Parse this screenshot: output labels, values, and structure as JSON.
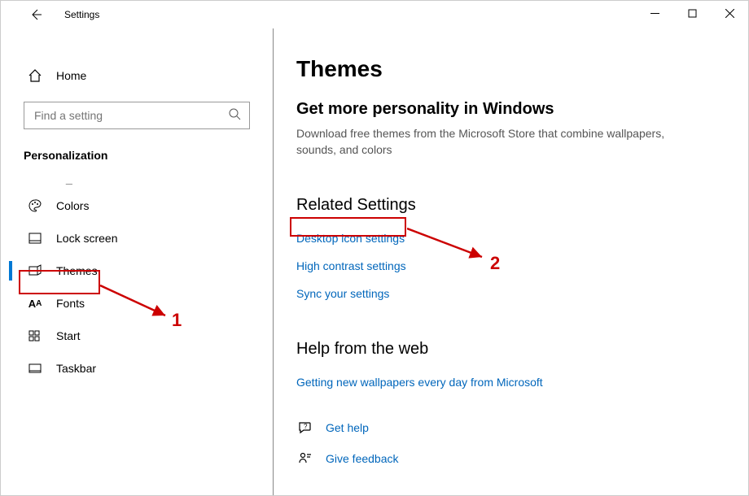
{
  "titlebar": {
    "app_title": "Settings"
  },
  "sidebar": {
    "home_label": "Home",
    "search_placeholder": "Find a setting",
    "section_label": "Personalization",
    "items": [
      {
        "label": "Colors"
      },
      {
        "label": "Lock screen"
      },
      {
        "label": "Themes"
      },
      {
        "label": "Fonts"
      },
      {
        "label": "Start"
      },
      {
        "label": "Taskbar"
      }
    ]
  },
  "main": {
    "page_title": "Themes",
    "subheading": "Get more personality in Windows",
    "description": "Download free themes from the Microsoft Store that combine wallpapers, sounds, and colors",
    "related_title": "Related Settings",
    "related_links": {
      "desktop_icon": "Desktop icon settings",
      "high_contrast": "High contrast settings",
      "sync": "Sync your settings"
    },
    "help_title": "Help from the web",
    "help_link": "Getting new wallpapers every day from Microsoft",
    "get_help": "Get help",
    "give_feedback": "Give feedback"
  },
  "annotations": {
    "label1": "1",
    "label2": "2"
  }
}
